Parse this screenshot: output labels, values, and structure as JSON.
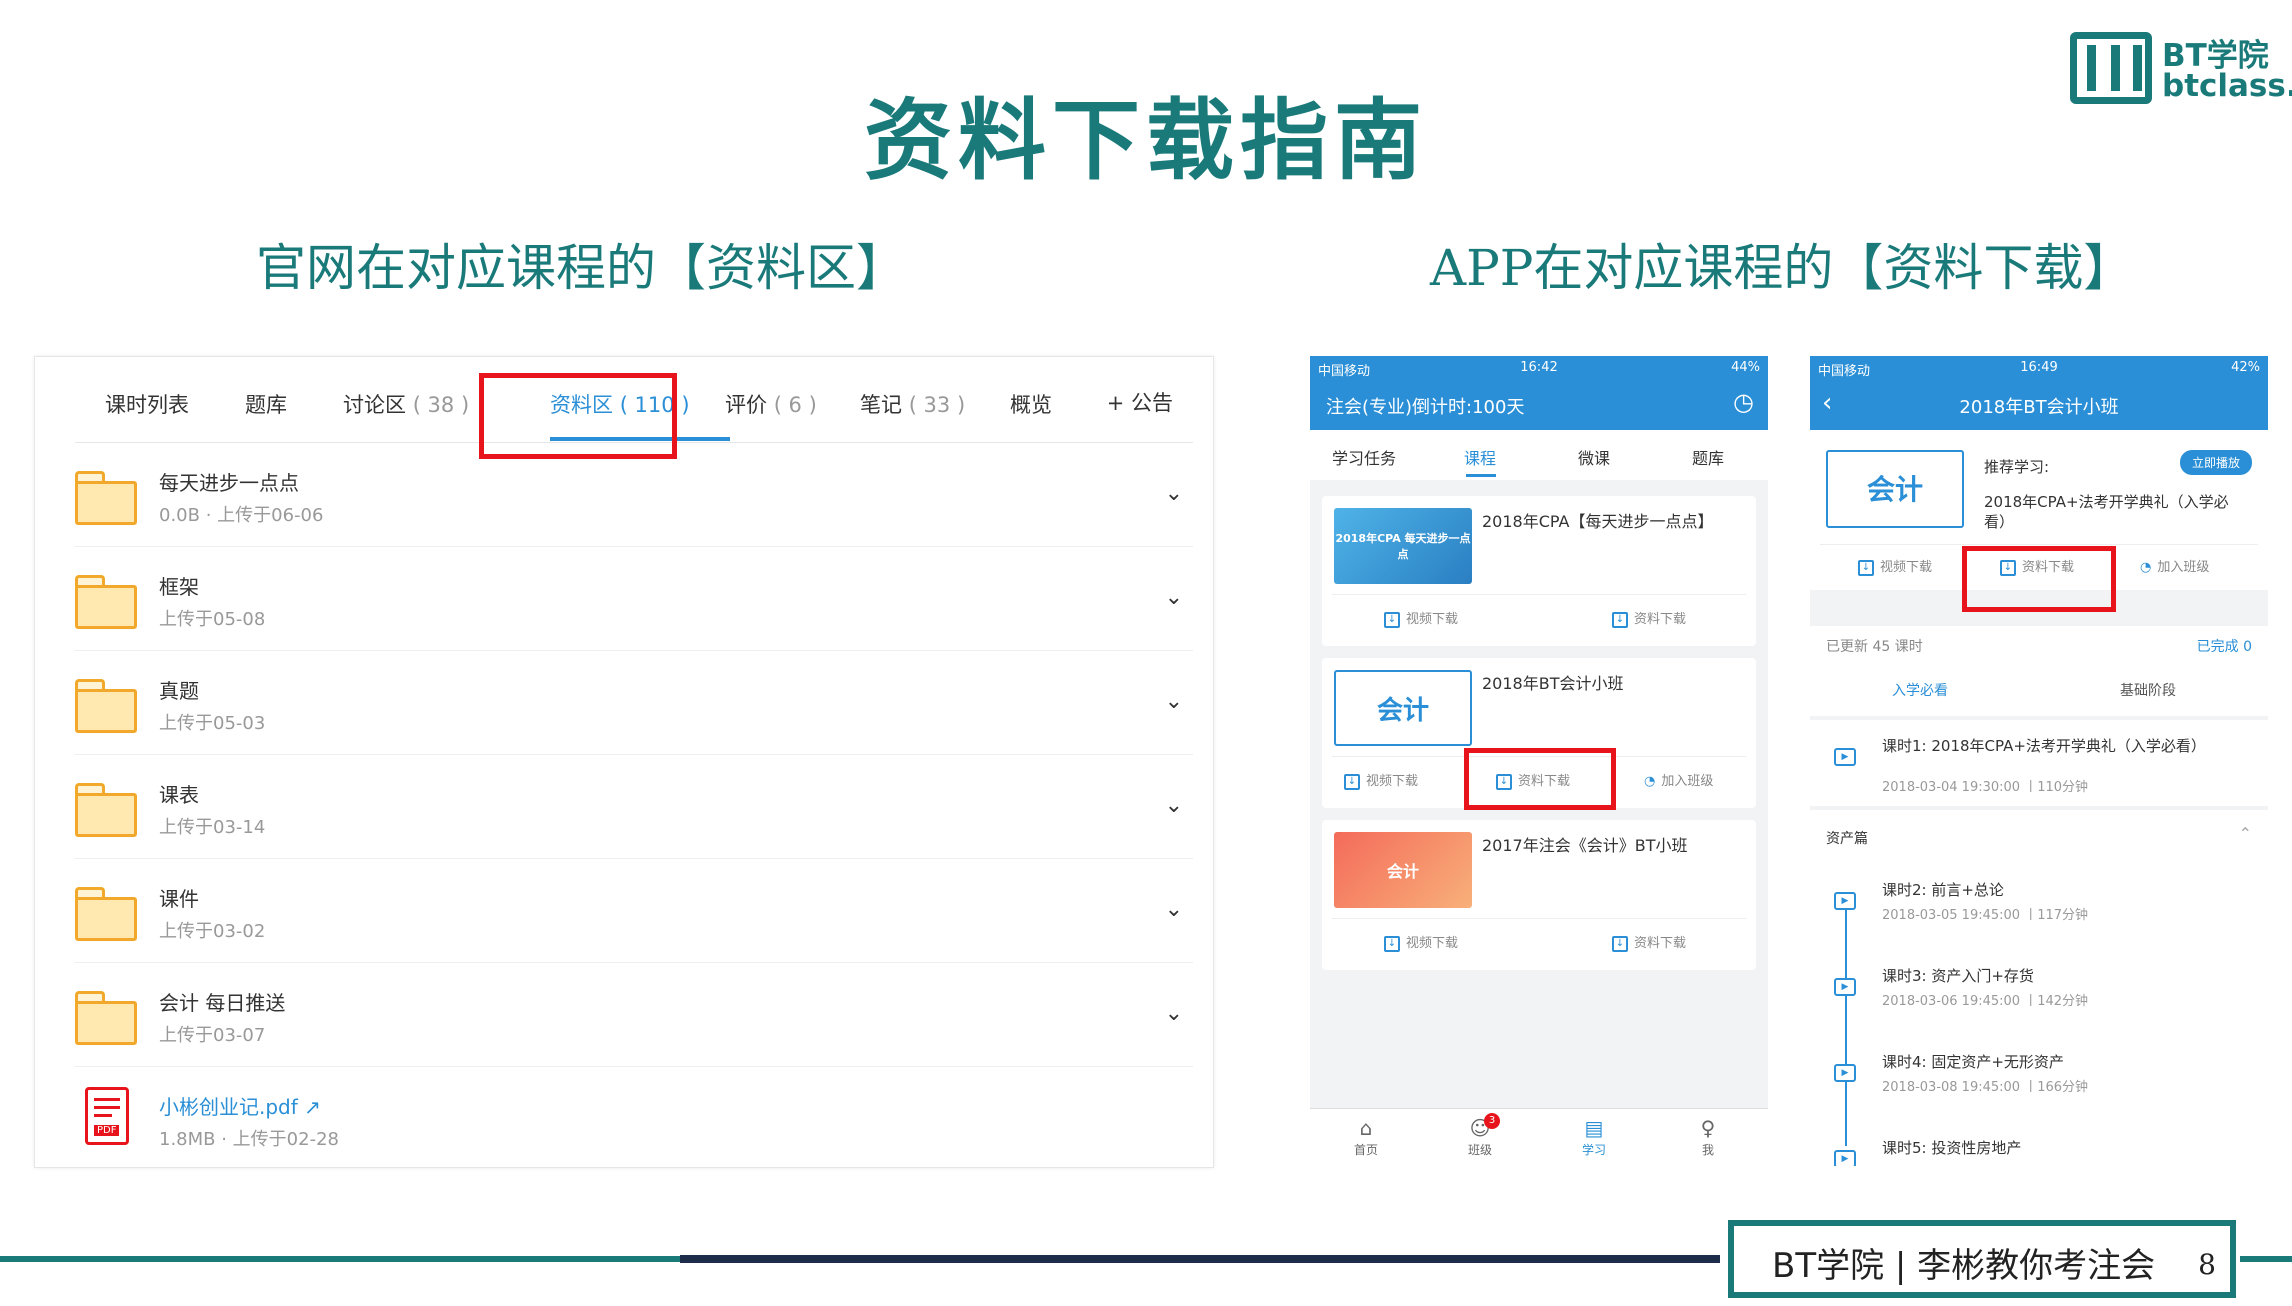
{
  "slide_title": "资料下载指南",
  "logo": {
    "line1": "BT学院",
    "line2": "btclass.cn"
  },
  "subtitle_left": "官网在对应课程的【资料区】",
  "subtitle_right": "APP在对应课程的【资料下载】",
  "web": {
    "tabs": [
      {
        "label": "课时列表",
        "count": ""
      },
      {
        "label": "题库",
        "count": ""
      },
      {
        "label": "讨论区",
        "count": "( 38 )"
      },
      {
        "label": "资料区",
        "count": "( 110 )"
      },
      {
        "label": "评价",
        "count": "( 6 )"
      },
      {
        "label": "笔记",
        "count": "( 33 )"
      },
      {
        "label": "概览",
        "count": ""
      }
    ],
    "announce": "+ 公告",
    "rows": [
      {
        "name": "每天进步一点点",
        "meta": "0.0B · 上传于06-06"
      },
      {
        "name": "框架",
        "meta": "上传于05-08"
      },
      {
        "name": "真题",
        "meta": "上传于05-03"
      },
      {
        "name": "课表",
        "meta": "上传于03-14"
      },
      {
        "name": "课件",
        "meta": "上传于03-02"
      },
      {
        "name": "会计 每日推送",
        "meta": "上传于03-07"
      }
    ],
    "file": {
      "name": "小彬创业记.pdf",
      "meta": "1.8MB · 上传于02-28",
      "badge": "PDF"
    }
  },
  "phone1": {
    "status": {
      "carrier": "中国移动",
      "time": "16:42",
      "battery": "44%"
    },
    "nav_title": "注会(专业)倒计时:100天",
    "tabs": [
      "学习任务",
      "课程",
      "微课",
      "题库"
    ],
    "cards": [
      {
        "title": "2018年CPA【每天进步一点点】",
        "thumb": "2018年CPA 每天进步一点点",
        "buttons": [
          "视频下载",
          "资料下载"
        ]
      },
      {
        "title": "2018年BT会计小班",
        "thumb": "会计",
        "buttons": [
          "视频下载",
          "资料下载",
          "加入班级"
        ]
      },
      {
        "title": "2017年注会《会计》BT小班",
        "thumb": "会计",
        "buttons": [
          "视频下载",
          "资料下载"
        ]
      }
    ],
    "bottom_nav": [
      "首页",
      "班级",
      "学习",
      "我"
    ],
    "badge": "3"
  },
  "phone2": {
    "status": {
      "carrier": "中国移动",
      "time": "16:49",
      "battery": "42%"
    },
    "nav_title": "2018年BT会计小班",
    "recommend_label": "推荐学习:",
    "play_button": "立即播放",
    "recommend_title": "2018年CPA+法考开学典礼（入学必看）",
    "thumb": "会计",
    "actions": [
      "视频下载",
      "资料下载",
      "加入班级"
    ],
    "updated": "已更新 45 课时",
    "completed": "已完成 0",
    "stage_tabs": [
      "入学必看",
      "基础阶段"
    ],
    "section": "资产篇",
    "lessons": [
      {
        "title": "课时1: 2018年CPA+法考开学典礼（入学必看）",
        "meta": "2018-03-04 19:30:00 丨110分钟"
      },
      {
        "title": "课时2: 前言+总论",
        "meta": "2018-03-05 19:45:00 丨117分钟"
      },
      {
        "title": "课时3: 资产入门+存货",
        "meta": "2018-03-06 19:45:00 丨142分钟"
      },
      {
        "title": "课时4: 固定资产+无形资产",
        "meta": "2018-03-08 19:45:00 丨166分钟"
      },
      {
        "title": "课时5: 投资性房地产",
        "meta": ""
      }
    ]
  },
  "footer": {
    "text": "BT学院 | 李彬教你考注会",
    "page": "8"
  },
  "colors": {
    "teal": "#1a7a7a",
    "blue": "#2a8fd6",
    "red": "#e8141b",
    "folder": "#f1a82b"
  }
}
